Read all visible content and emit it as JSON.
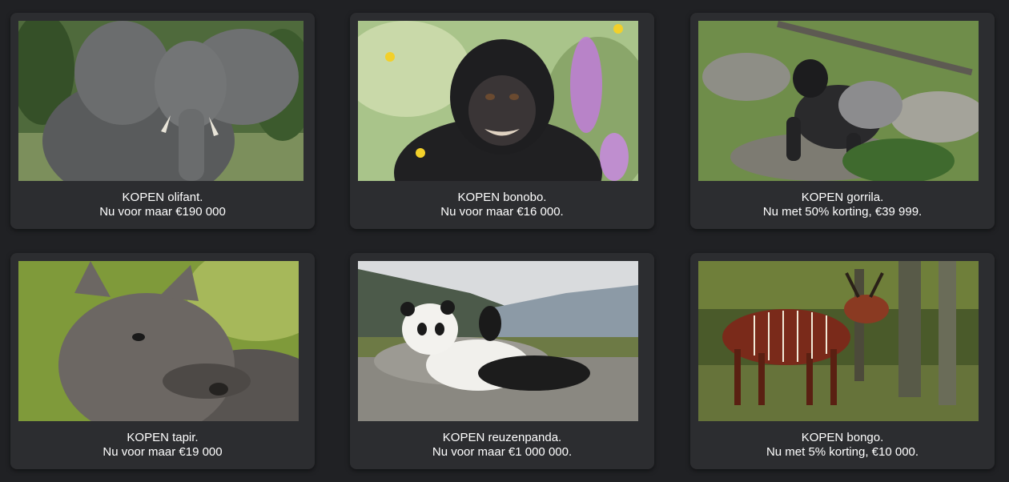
{
  "cards": [
    {
      "animal": "olifant",
      "title": "KOPEN olifant.",
      "price": "Nu voor maar €190 000",
      "icon": "elephant-image"
    },
    {
      "animal": "bonobo",
      "title": "KOPEN bonobo.",
      "price": "Nu voor maar €16 000.",
      "icon": "bonobo-image"
    },
    {
      "animal": "gorrila",
      "title": "KOPEN gorrila.",
      "price": "Nu met 50% korting, €39 999.",
      "icon": "gorilla-image"
    },
    {
      "animal": "tapir",
      "title": "KOPEN tapir.",
      "price": "Nu voor maar €19 000",
      "icon": "tapir-image"
    },
    {
      "animal": "reuzenpanda",
      "title": "KOPEN reuzenpanda.",
      "price": "Nu voor maar €1 000 000.",
      "icon": "panda-image"
    },
    {
      "animal": "bongo",
      "title": "KOPEN bongo.",
      "price": "Nu met 5% korting, €10 000.",
      "icon": "bongo-image"
    }
  ],
  "colors": {
    "background": "#202124",
    "card": "#2c2d30",
    "text": "#ffffff"
  }
}
